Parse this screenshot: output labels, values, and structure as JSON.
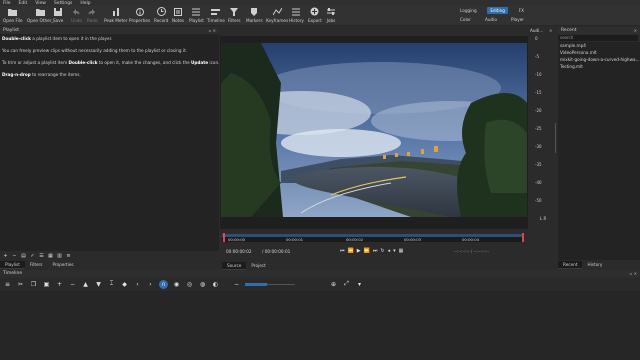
{
  "menu": [
    "File",
    "Edit",
    "View",
    "Settings",
    "Help"
  ],
  "toolbar": [
    {
      "label": "Open File",
      "icon": "open-file-icon"
    },
    {
      "label": "Open Other_",
      "icon": "open-other-icon"
    },
    {
      "label": "Save",
      "icon": "save-icon"
    },
    {
      "label": "Undo",
      "icon": "undo-icon"
    },
    {
      "label": "Redo",
      "icon": "redo-icon"
    },
    {
      "label": "Peak Meter",
      "icon": "peak-meter-icon"
    },
    {
      "label": "Properties",
      "icon": "properties-icon"
    },
    {
      "label": "Record",
      "icon": "record-icon"
    },
    {
      "label": "Notes",
      "icon": "notes-icon"
    },
    {
      "label": "Playlist",
      "icon": "playlist-icon"
    },
    {
      "label": "Timeline",
      "icon": "timeline-icon"
    },
    {
      "label": "Filters",
      "icon": "filters-icon"
    },
    {
      "label": "Markers",
      "icon": "markers-icon"
    },
    {
      "label": "Keyframes",
      "icon": "keyframes-icon"
    },
    {
      "label": "History",
      "icon": "history-icon"
    },
    {
      "label": "Export",
      "icon": "export-icon"
    },
    {
      "label": "Jobs",
      "icon": "jobs-icon"
    }
  ],
  "layouts": {
    "row1": [
      "Logging",
      "Editing",
      "FX"
    ],
    "row2": [
      "Color",
      "Audio",
      "Player"
    ],
    "active": "Editing"
  },
  "playlist": {
    "title": "Playlist",
    "help": [
      {
        "b": "Double-click",
        "t": " a playlist item to open it in the player."
      },
      {
        "b": "",
        "t": "You can freely preview clips without necessarily adding them to the playlist or closing it."
      },
      {
        "b": "",
        "t": "To trim or adjust a playlist item ",
        "b2": "Double-click",
        "t2": " to open it, make the changes, and click the ",
        "b3": "Update",
        "t3": " icon."
      },
      {
        "b": "Drag-n-drop",
        "t": " to rearrange the items."
      }
    ],
    "tabs": [
      "Playlist",
      "Filters",
      "Properties"
    ]
  },
  "audio_meter": {
    "title": "Audi...",
    "ticks": [
      "0",
      "-5",
      "-10",
      "-15",
      "-20",
      "-25",
      "-30",
      "-35",
      "-40",
      "-50"
    ],
    "channels": "L  R"
  },
  "ruler": [
    "00:00:00",
    "00:00:01",
    "00:00:02",
    "00:00:03",
    "00:00:04"
  ],
  "timecode": {
    "current": "00:00:00:02",
    "duration": "/ 00:00:00:01",
    "in_out": "--:--:--:-- / --:--:--:--"
  },
  "viewer_tabs": [
    "Source",
    "Project"
  ],
  "recent": {
    "title": "Recent",
    "search_placeholder": "search",
    "items": [
      "sample.mp4",
      "VideoPersona.mlt",
      "mixkit-going-down-a-curved-highwa...",
      "Testing.mlt"
    ],
    "tabs": [
      "Recent",
      "History"
    ]
  },
  "timeline": {
    "title": "Timeline"
  },
  "colors": {
    "accent": "#2f6fb0",
    "panel": "#232323",
    "record": "#e04848"
  }
}
